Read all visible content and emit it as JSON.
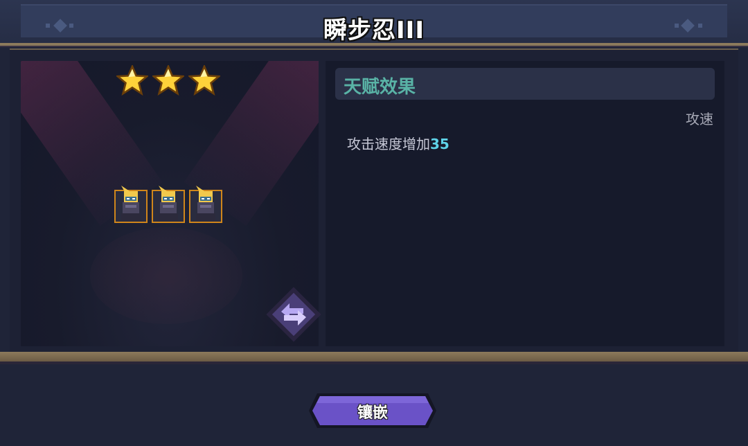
{
  "title": "瞬步忍III",
  "rating": {
    "stars": 3
  },
  "units": [
    {
      "name": "unit-1"
    },
    {
      "name": "unit-2"
    },
    {
      "name": "unit-3"
    }
  ],
  "talent": {
    "header": "天赋效果",
    "tag": "攻速",
    "description_prefix": "攻击速度增加",
    "description_value": "35"
  },
  "buttons": {
    "embed_label": "镶嵌",
    "swap_icon": "swap-arrows-icon"
  },
  "colors": {
    "accent_button": "#6a52c7",
    "talent_header_text": "#59b3a6",
    "value_highlight": "#5fd3e8",
    "unit_border": "#d0861b",
    "star": "#ffd23a"
  }
}
